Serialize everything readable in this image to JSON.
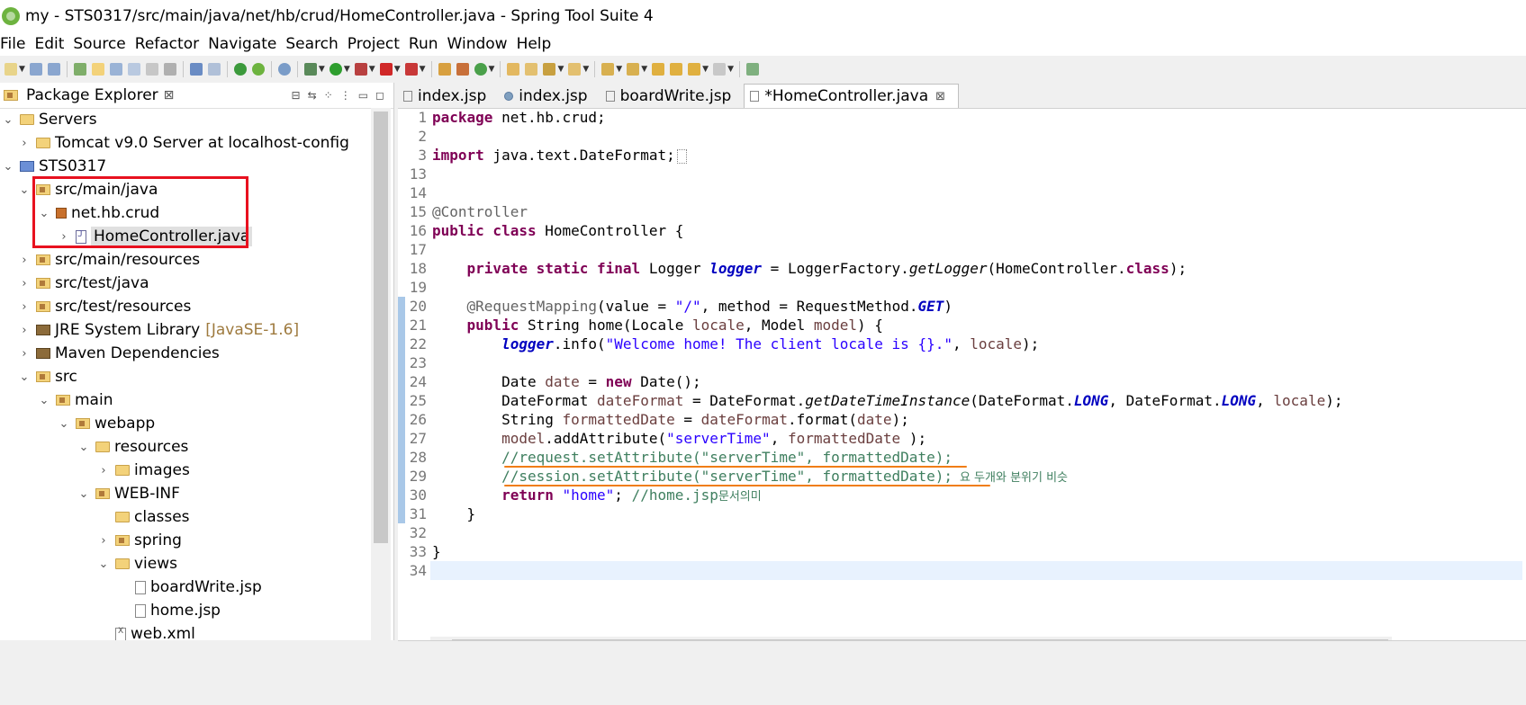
{
  "window": {
    "title": "my - STS0317/src/main/java/net/hb/crud/HomeController.java - Spring Tool Suite 4"
  },
  "menu": [
    "File",
    "Edit",
    "Source",
    "Refactor",
    "Navigate",
    "Search",
    "Project",
    "Run",
    "Window",
    "Help"
  ],
  "package_explorer": {
    "title": "Package Explorer",
    "close": "⊠",
    "tree": [
      {
        "label": "Servers",
        "extra": ""
      },
      {
        "label": "Tomcat v9.0 Server at localhost-config",
        "extra": ""
      },
      {
        "label": "STS0317",
        "extra": ""
      },
      {
        "label": "src/main/java",
        "extra": ""
      },
      {
        "label": "net.hb.crud",
        "extra": ""
      },
      {
        "label": "HomeController.java",
        "extra": ""
      },
      {
        "label": "src/main/resources",
        "extra": ""
      },
      {
        "label": "src/test/java",
        "extra": ""
      },
      {
        "label": "src/test/resources",
        "extra": ""
      },
      {
        "label": "JRE System Library",
        "extra": "[JavaSE-1.6]"
      },
      {
        "label": "Maven Dependencies",
        "extra": ""
      },
      {
        "label": "src",
        "extra": ""
      },
      {
        "label": "main",
        "extra": ""
      },
      {
        "label": "webapp",
        "extra": ""
      },
      {
        "label": "resources",
        "extra": ""
      },
      {
        "label": "images",
        "extra": ""
      },
      {
        "label": "WEB-INF",
        "extra": ""
      },
      {
        "label": "classes",
        "extra": ""
      },
      {
        "label": "spring",
        "extra": ""
      },
      {
        "label": "views",
        "extra": ""
      },
      {
        "label": "boardWrite.jsp",
        "extra": ""
      },
      {
        "label": "home.jsp",
        "extra": ""
      },
      {
        "label": "web.xml",
        "extra": ""
      }
    ]
  },
  "editor": {
    "tabs": [
      {
        "label": "index.jsp"
      },
      {
        "label": "index.jsp"
      },
      {
        "label": "boardWrite.jsp"
      },
      {
        "label": "*HomeController.java",
        "close": "⊠"
      }
    ],
    "line_numbers": [
      "1",
      "2",
      "3",
      "13",
      "14",
      "15",
      "16",
      "17",
      "18",
      "19",
      "20",
      "21",
      "22",
      "23",
      "24",
      "25",
      "26",
      "27",
      "28",
      "29",
      "30",
      "31",
      "32",
      "33",
      "34"
    ],
    "code": {
      "l1_kw": "package",
      "l1_rest": " net.hb.crud;",
      "l3_kw": "import",
      "l3_rest": " java.text.DateFormat;",
      "l15": "@Controller",
      "l16_kw": "public class",
      "l16_rest": " HomeController {",
      "l18_kw": "private static final",
      "l18_a": " Logger ",
      "l18_field": "logger",
      "l18_b": " = LoggerFactory.",
      "l18_m": "getLogger",
      "l18_c": "(HomeController.",
      "l18_kw2": "class",
      "l18_d": ");",
      "l20_ann": "@RequestMapping",
      "l20_a": "(value = ",
      "l20_str": "\"/\"",
      "l20_b": ", method = RequestMethod.",
      "l20_f": "GET",
      "l20_c": ")",
      "l21_kw": "public",
      "l21_a": " String home(Locale ",
      "l21_p1": "locale",
      "l21_b": ", Model ",
      "l21_p2": "model",
      "l21_c": ") {",
      "l22_field": "logger",
      "l22_a": ".info(",
      "l22_str": "\"Welcome home! The client locale is {}.\"",
      "l22_b": ", ",
      "l22_p": "locale",
      "l22_c": ");",
      "l24_a": "Date ",
      "l24_p": "date",
      "l24_b": " = ",
      "l24_kw": "new",
      "l24_c": " Date();",
      "l25_a": "DateFormat ",
      "l25_p": "dateFormat",
      "l25_b": " = DateFormat.",
      "l25_m": "getDateTimeInstance",
      "l25_c": "(DateFormat.",
      "l25_f1": "LONG",
      "l25_d": ", DateFormat.",
      "l25_f2": "LONG",
      "l25_e": ", ",
      "l25_p2": "locale",
      "l25_g": ");",
      "l26_a": "String ",
      "l26_p": "formattedDate",
      "l26_b": " = ",
      "l26_p2": "dateFormat",
      "l26_c": ".format(",
      "l26_p3": "date",
      "l26_d": ");",
      "l27_p": "model",
      "l27_a": ".addAttribute(",
      "l27_str": "\"serverTime\"",
      "l27_b": ", ",
      "l27_p2": "formattedDate",
      "l27_c": " );",
      "l28": "//request.setAttribute(\"serverTime\", formattedDate);",
      "l29": "//session.setAttribute(\"serverTime\", formattedDate);",
      "l29_note": "요 두개와 분위기 비슷",
      "l30_kw": "return",
      "l30_str": " \"home\"",
      "l30_a": "; ",
      "l30_cmt": "//home.jsp",
      "l30_note": "문서의미",
      "l31": "}",
      "l33": "}"
    }
  },
  "colors": {
    "highlight_box": "#e8111f",
    "underline": "#f07d13",
    "keyword": "#7f0055",
    "string": "#2a00ff",
    "comment": "#3f7f5f"
  }
}
